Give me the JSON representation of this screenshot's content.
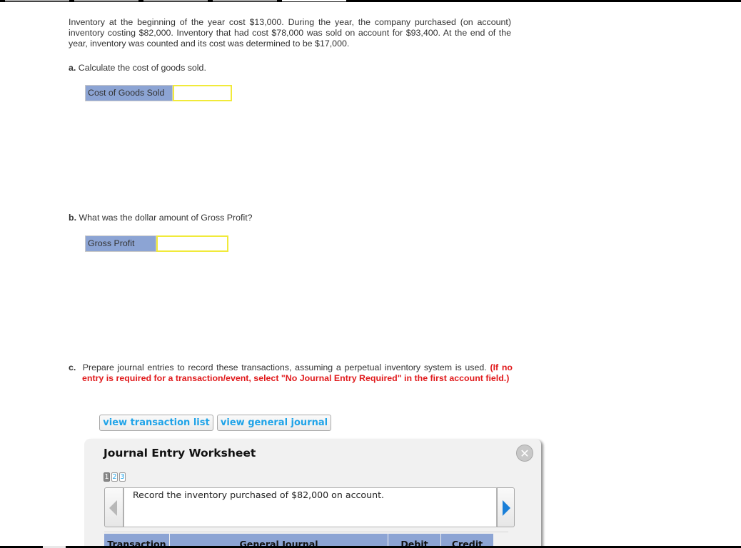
{
  "top_tabs": [
    {
      "state": "inactive"
    },
    {
      "state": "inactive"
    },
    {
      "state": "inactive"
    },
    {
      "state": "inactive"
    },
    {
      "state": "active"
    }
  ],
  "question": {
    "text": "Inventory at the beginning of the year cost $13,000. During the year, the company purchased (on account) inventory costing $82,000. Inventory that had cost $78,000 was sold on account for $93,400. At the end of the year, inventory was counted and its cost was determined to be $17,000."
  },
  "part_a": {
    "letter": "a.",
    "prompt": "Calculate the cost of goods sold.",
    "field_label": "Cost of Goods Sold",
    "field_value": ""
  },
  "part_b": {
    "letter": "b.",
    "prompt": "What was the dollar amount of Gross Profit?",
    "field_label": "Gross Profit",
    "field_value": ""
  },
  "part_c": {
    "letter": "c.",
    "prompt": "Prepare journal entries to record these transactions, assuming a perpetual inventory system is used.",
    "instruction": "(If no entry is required for a transaction/event, select \"No Journal Entry Required\" in the first account field.)"
  },
  "buttons": {
    "view_transaction_list": "view transaction list",
    "view_general_journal": "view general journal"
  },
  "worksheet": {
    "title": "Journal Entry Worksheet",
    "close_symbol": "✕",
    "pages": [
      "1",
      "2",
      "3"
    ],
    "current_page": "1",
    "description": "Record the inventory purchased of $82,000 on account.",
    "columns": [
      "Transaction",
      "General Journal",
      "Debit",
      "Credit"
    ]
  },
  "colors": {
    "label_bg": "#8ca4d4",
    "input_border": "#f1ea3a",
    "link_blue": "#1fa3e8",
    "instruction_red": "#e0191b",
    "nav_arrow_blue": "#1a7fd8"
  }
}
